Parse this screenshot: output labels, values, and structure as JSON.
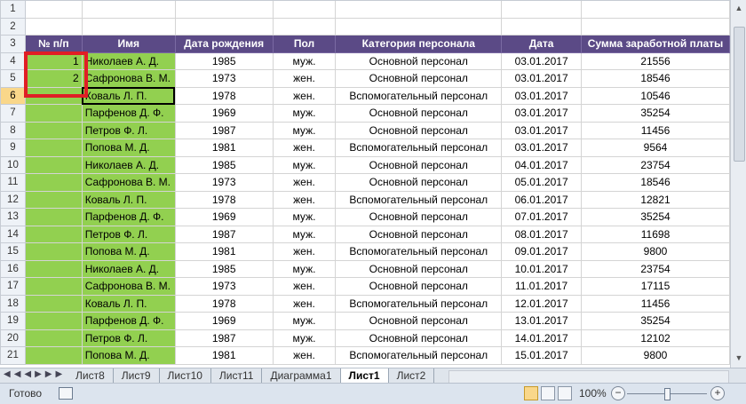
{
  "headers": [
    "№ п/п",
    "Имя",
    "Дата рождения",
    "Пол",
    "Категория персонала",
    "Дата",
    "Сумма заработной платы"
  ],
  "rows": [
    [
      "1",
      "Николаев А. Д.",
      "1985",
      "муж.",
      "Основной персонал",
      "03.01.2017",
      "21556"
    ],
    [
      "2",
      "Сафронова В. М.",
      "1973",
      "жен.",
      "Основной персонал",
      "03.01.2017",
      "18546"
    ],
    [
      "",
      "Коваль Л. П.",
      "1978",
      "жен.",
      "Вспомогательный персонал",
      "03.01.2017",
      "10546"
    ],
    [
      "",
      "Парфенов Д. Ф.",
      "1969",
      "муж.",
      "Основной персонал",
      "03.01.2017",
      "35254"
    ],
    [
      "",
      "Петров Ф. Л.",
      "1987",
      "муж.",
      "Основной персонал",
      "03.01.2017",
      "11456"
    ],
    [
      "",
      "Попова М. Д.",
      "1981",
      "жен.",
      "Вспомогательный персонал",
      "03.01.2017",
      "9564"
    ],
    [
      "",
      "Николаев А. Д.",
      "1985",
      "муж.",
      "Основной персонал",
      "04.01.2017",
      "23754"
    ],
    [
      "",
      "Сафронова В. М.",
      "1973",
      "жен.",
      "Основной персонал",
      "05.01.2017",
      "18546"
    ],
    [
      "",
      "Коваль Л. П.",
      "1978",
      "жен.",
      "Вспомогательный персонал",
      "06.01.2017",
      "12821"
    ],
    [
      "",
      "Парфенов Д. Ф.",
      "1969",
      "муж.",
      "Основной персонал",
      "07.01.2017",
      "35254"
    ],
    [
      "",
      "Петров Ф. Л.",
      "1987",
      "муж.",
      "Основной персонал",
      "08.01.2017",
      "11698"
    ],
    [
      "",
      "Попова М. Д.",
      "1981",
      "жен.",
      "Вспомогательный персонал",
      "09.01.2017",
      "9800"
    ],
    [
      "",
      "Николаев А. Д.",
      "1985",
      "муж.",
      "Основной персонал",
      "10.01.2017",
      "23754"
    ],
    [
      "",
      "Сафронова В. М.",
      "1973",
      "жен.",
      "Основной персонал",
      "11.01.2017",
      "17115"
    ],
    [
      "",
      "Коваль Л. П.",
      "1978",
      "жен.",
      "Вспомогательный персонал",
      "12.01.2017",
      "11456"
    ],
    [
      "",
      "Парфенов Д. Ф.",
      "1969",
      "муж.",
      "Основной персонал",
      "13.01.2017",
      "35254"
    ],
    [
      "",
      "Петров Ф. Л.",
      "1987",
      "муж.",
      "Основной персонал",
      "14.01.2017",
      "12102"
    ],
    [
      "",
      "Попова М. Д.",
      "1981",
      "жен.",
      "Вспомогательный персонал",
      "15.01.2017",
      "9800"
    ]
  ],
  "row_numbers": [
    "1",
    "2",
    "3",
    "4",
    "5",
    "6",
    "7",
    "8",
    "9",
    "10",
    "11",
    "12",
    "13",
    "14",
    "15",
    "16",
    "17",
    "18",
    "19",
    "20",
    "21"
  ],
  "active_row": "6",
  "tabs": [
    "Лист8",
    "Лист9",
    "Лист10",
    "Лист11",
    "Диаграмма1",
    "Лист1",
    "Лист2"
  ],
  "active_tab": "Лист1",
  "status": {
    "ready": "Готово",
    "zoom": "100%",
    "zoom_minus": "−",
    "zoom_plus": "+"
  },
  "colors": {
    "header_bg": "#5b4a86",
    "green_fill": "#92d050",
    "highlight": "#e01e25"
  }
}
